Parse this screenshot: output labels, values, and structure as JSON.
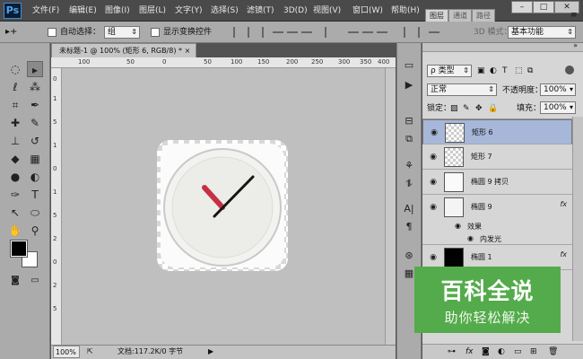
{
  "app": {
    "logo": "Ps"
  },
  "menu": [
    "文件(F)",
    "编辑(E)",
    "图像(I)",
    "图层(L)",
    "文字(Y)",
    "选择(S)",
    "滤镜(T)",
    "3D(D)",
    "视图(V)",
    "窗口(W)",
    "帮助(H)"
  ],
  "window_controls": {
    "minimize": "–",
    "maximize": "□",
    "close": "✕"
  },
  "options": {
    "move_tool": "▸+",
    "auto_select_label": "自动选择：",
    "auto_select_value": "组",
    "show_transform_label": "显示变换控件",
    "mode_3d": "3D 模式：",
    "workspace": "基本功能"
  },
  "document": {
    "tab_title": "未标题-1 @ 100% (矩形 6, RGB/8) *",
    "tab_close": "×",
    "ruler_h": [
      "100",
      "50",
      "0",
      "50",
      "100",
      "150",
      "200",
      "250",
      "300",
      "350",
      "400"
    ],
    "ruler_v": [
      "0",
      "1",
      "5",
      "1",
      "0",
      "1",
      "5",
      "2",
      "0",
      "2",
      "5"
    ],
    "zoom": "100%",
    "doc_info": "文档:117.2K/0 字节",
    "status_arrow": "▶"
  },
  "layers_panel": {
    "tabs": [
      "图层",
      "通道",
      "路径"
    ],
    "filter_label": "ρ 类型",
    "blend_mode": "正常",
    "opacity_label": "不透明度：",
    "opacity_value": "100%",
    "lock_label": "锁定：",
    "fill_label": "填充：",
    "fill_value": "100%",
    "layers": [
      {
        "name": "矩形 6",
        "selected": true
      },
      {
        "name": "矩形 7",
        "selected": false
      },
      {
        "name": "椭圆 9 拷贝",
        "selected": false
      },
      {
        "name": "椭圆 9",
        "selected": false,
        "fx": "fx"
      },
      {
        "name": "椭圆 1",
        "selected": false,
        "fx": "fx"
      }
    ],
    "effects_label": "效果",
    "outer_glow_label": "内发光",
    "footer_icons": [
      "link-icon",
      "fx-icon",
      "mask-icon",
      "adjustment-icon",
      "group-icon",
      "new-layer-icon",
      "trash-icon"
    ]
  },
  "watermark": {
    "title": "百科全说",
    "subtitle": "助你轻松解决"
  },
  "colors": {
    "menubar": "#4a4a4a",
    "panel": "#ababab",
    "selected_layer": "#a7b7d9",
    "clock_hand_red": "#c53043",
    "watermark_green": "#54ab4b"
  }
}
